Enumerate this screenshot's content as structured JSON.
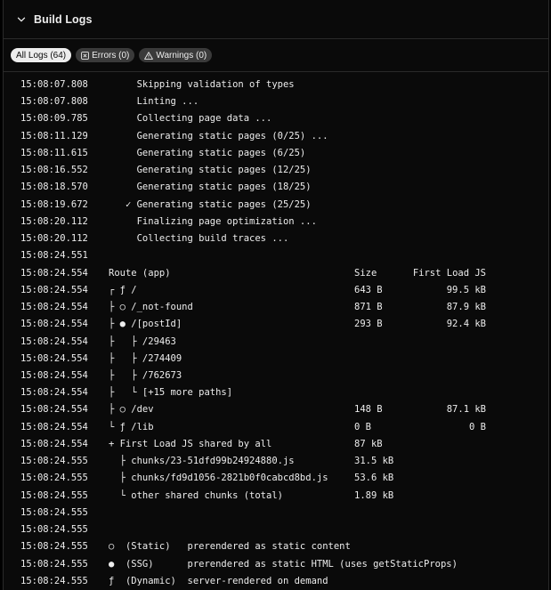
{
  "header": {
    "title": "Build Logs",
    "chevron_icon": "chevron-down-icon"
  },
  "filters": [
    {
      "label": "All Logs (64)",
      "active": true,
      "icon": ""
    },
    {
      "label": "Errors (0)",
      "active": false,
      "icon": "error-square-icon"
    },
    {
      "label": "Warnings (0)",
      "active": false,
      "icon": "warning-triangle-icon"
    }
  ],
  "logs": [
    {
      "ts": "15:08:07.808",
      "msg": "     Skipping validation of types",
      "size": "",
      "first_load": ""
    },
    {
      "ts": "15:08:07.808",
      "msg": "     Linting ...",
      "size": "",
      "first_load": ""
    },
    {
      "ts": "15:08:09.785",
      "msg": "     Collecting page data ...",
      "size": "",
      "first_load": ""
    },
    {
      "ts": "15:08:11.129",
      "msg": "     Generating static pages (0/25) ...",
      "size": "",
      "first_load": ""
    },
    {
      "ts": "15:08:11.615",
      "msg": "     Generating static pages (6/25)",
      "size": "",
      "first_load": ""
    },
    {
      "ts": "15:08:16.552",
      "msg": "     Generating static pages (12/25)",
      "size": "",
      "first_load": ""
    },
    {
      "ts": "15:08:18.570",
      "msg": "     Generating static pages (18/25)",
      "size": "",
      "first_load": ""
    },
    {
      "ts": "15:08:19.672",
      "msg": "   ✓ Generating static pages (25/25)",
      "size": "",
      "first_load": ""
    },
    {
      "ts": "15:08:20.112",
      "msg": "     Finalizing page optimization ...",
      "size": "",
      "first_load": ""
    },
    {
      "ts": "15:08:20.112",
      "msg": "     Collecting build traces ...",
      "size": "",
      "first_load": ""
    },
    {
      "ts": "15:08:24.551",
      "msg": "",
      "size": "",
      "first_load": ""
    },
    {
      "ts": "15:08:24.554",
      "msg": "Route (app)",
      "size": "Size",
      "first_load": "First Load JS"
    },
    {
      "ts": "15:08:24.554",
      "msg": "┌ ƒ /",
      "size": "643 B",
      "first_load": "99.5 kB"
    },
    {
      "ts": "15:08:24.554",
      "msg": "├ ○ /_not-found",
      "size": "871 B",
      "first_load": "87.9 kB"
    },
    {
      "ts": "15:08:24.554",
      "msg": "├ ● /[postId]",
      "size": "293 B",
      "first_load": "92.4 kB"
    },
    {
      "ts": "15:08:24.554",
      "msg": "├   ├ /29463",
      "size": "",
      "first_load": ""
    },
    {
      "ts": "15:08:24.554",
      "msg": "├   ├ /274409",
      "size": "",
      "first_load": ""
    },
    {
      "ts": "15:08:24.554",
      "msg": "├   ├ /762673",
      "size": "",
      "first_load": ""
    },
    {
      "ts": "15:08:24.554",
      "msg": "├   └ [+15 more paths]",
      "size": "",
      "first_load": ""
    },
    {
      "ts": "15:08:24.554",
      "msg": "├ ○ /dev",
      "size": "148 B",
      "first_load": "87.1 kB"
    },
    {
      "ts": "15:08:24.554",
      "msg": "└ ƒ /lib",
      "size": "0 B",
      "first_load": "0 B"
    },
    {
      "ts": "15:08:24.554",
      "msg": "+ First Load JS shared by all",
      "size": "87 kB",
      "first_load": ""
    },
    {
      "ts": "15:08:24.555",
      "msg": "  ├ chunks/23-51dfd99b24924880.js",
      "size": "31.5 kB",
      "first_load": ""
    },
    {
      "ts": "15:08:24.555",
      "msg": "  ├ chunks/fd9d1056-2821b0f0cabcd8bd.js",
      "size": "53.6 kB",
      "first_load": ""
    },
    {
      "ts": "15:08:24.555",
      "msg": "  └ other shared chunks (total)",
      "size": "1.89 kB",
      "first_load": ""
    },
    {
      "ts": "15:08:24.555",
      "msg": "",
      "size": "",
      "first_load": ""
    },
    {
      "ts": "15:08:24.555",
      "msg": "",
      "size": "",
      "first_load": ""
    },
    {
      "ts": "15:08:24.555",
      "msg": "○  (Static)   prerendered as static content",
      "size": "",
      "first_load": ""
    },
    {
      "ts": "15:08:24.555",
      "msg": "●  (SSG)      prerendered as static HTML (uses getStaticProps)",
      "size": "",
      "first_load": ""
    },
    {
      "ts": "15:08:24.555",
      "msg": "ƒ  (Dynamic)  server-rendered on demand",
      "size": "",
      "first_load": ""
    }
  ],
  "colors": {
    "background": "#0a0a0a",
    "text": "#ededed",
    "active_pill_bg": "#ededed",
    "inactive_pill_bg": "#3a3a3a",
    "border": "#2a2a2a"
  }
}
